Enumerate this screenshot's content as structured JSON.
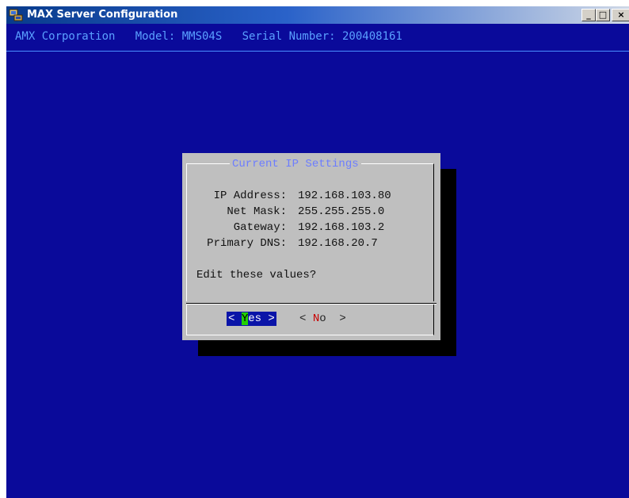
{
  "window": {
    "title": "MAX Server Configuration",
    "controls": {
      "minimize": "_",
      "maximize": "□",
      "close": "×"
    }
  },
  "header": {
    "text": "AMX Corporation   Model: MMS04S   Serial Number: 200408161"
  },
  "dialog": {
    "title": "Current IP Settings",
    "fields": [
      {
        "label": "IP Address:",
        "value": "192.168.103.80"
      },
      {
        "label": "Net Mask:",
        "value": "255.255.255.0"
      },
      {
        "label": "Gateway:",
        "value": "192.168.103.2"
      },
      {
        "label": "Primary DNS:",
        "value": "192.168.20.7"
      }
    ],
    "prompt": "Edit these values?",
    "buttons": {
      "yes": {
        "prefix": "< ",
        "hotkey": "Y",
        "rest": "es >"
      },
      "no": {
        "prefix": "< ",
        "hotkey": "N",
        "rest": "o  >"
      }
    }
  },
  "colors": {
    "terminal_background": "#0a0a9a",
    "header_text": "#5aa0ff",
    "dialog_background": "#bfbfbf",
    "dialog_title": "#6c7dff",
    "selected_button": "#0a14a8",
    "hotkey_highlight": "#22d000",
    "no_hotkey": "#c80000"
  }
}
